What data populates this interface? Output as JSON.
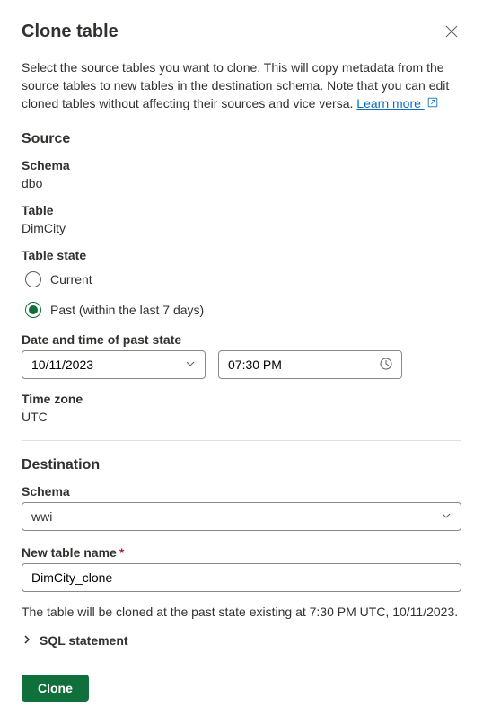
{
  "header": {
    "title": "Clone table"
  },
  "description": {
    "text": "Select the source tables you want to clone. This will copy metadata from the source tables to new tables in the destination schema. Note that you can edit cloned tables without affecting their sources and vice versa. ",
    "link_label": "Learn more "
  },
  "source": {
    "heading": "Source",
    "schema_label": "Schema",
    "schema_value": "dbo",
    "table_label": "Table",
    "table_value": "DimCity",
    "state_label": "Table state",
    "radio_current": "Current",
    "radio_past": "Past (within the last 7 days)",
    "datetime_label": "Date and time of past state",
    "date_value": "10/11/2023",
    "time_value": "07:30 PM",
    "tz_label": "Time zone",
    "tz_value": "UTC"
  },
  "destination": {
    "heading": "Destination",
    "schema_label": "Schema",
    "schema_value": "wwi",
    "newname_label": "New table name",
    "newname_value": "DimCity_clone"
  },
  "footer": {
    "note": "The table will be cloned at the past state existing at 7:30 PM UTC, 10/11/2023.",
    "sql_label": "SQL statement",
    "clone_label": "Clone"
  }
}
